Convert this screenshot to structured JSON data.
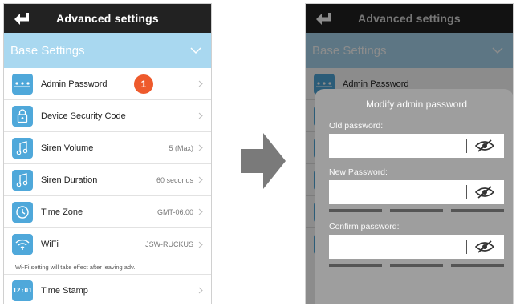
{
  "screen": {
    "title": "Advanced settings",
    "section": "Base Settings"
  },
  "items": [
    {
      "label": "Admin Password",
      "value": "",
      "icon": "dots-icon"
    },
    {
      "label": "Device Security Code",
      "value": "",
      "icon": "lock-icon"
    },
    {
      "label": "Siren Volume",
      "value": "5 (Max)",
      "icon": "music-note-icon"
    },
    {
      "label": "Siren Duration",
      "value": "60 seconds",
      "icon": "music-note-icon"
    },
    {
      "label": "Time Zone",
      "value": "GMT-06:00",
      "icon": "clock-icon"
    },
    {
      "label": "WiFi",
      "value": "JSW-RUCKUS",
      "icon": "wifi-icon"
    },
    {
      "label": "Time Stamp",
      "value": "",
      "icon": "digital-clock-icon"
    }
  ],
  "wifi_note": "Wi-Fi setting will take effect after leaving adv.",
  "step_badge": "1",
  "digital_clock_glyph": "12:01",
  "modal": {
    "title": "Modify admin password",
    "old_label": "Old password:",
    "new_label": "New Password:",
    "confirm_label": "Confirm password:"
  },
  "colors": {
    "topbar": "#222222",
    "section": "#a9d8f0",
    "icon": "#4fa8da",
    "badge": "#ee5a2c",
    "arrow": "#7a7a7a"
  }
}
